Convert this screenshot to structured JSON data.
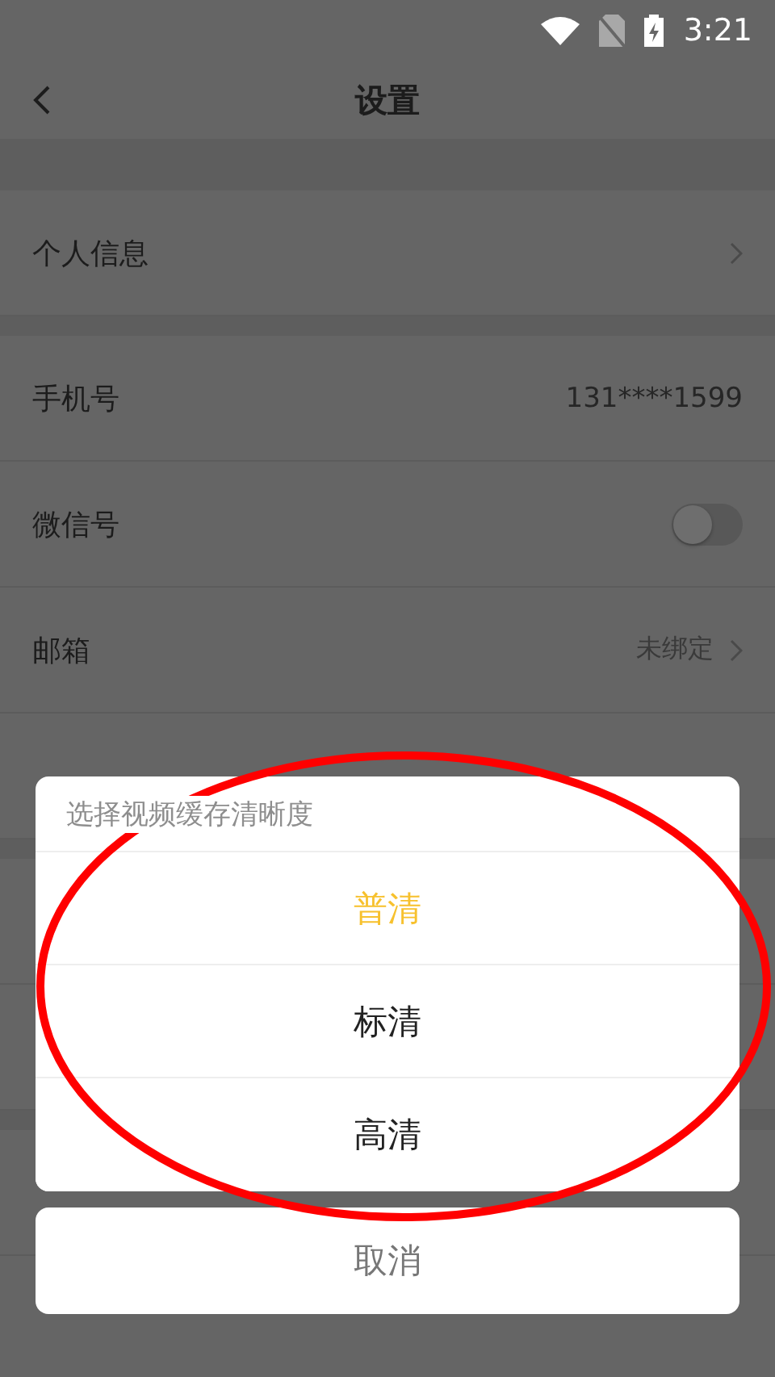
{
  "status_bar": {
    "time": "3:21"
  },
  "header": {
    "title": "设置"
  },
  "groups": [
    {
      "rows": [
        {
          "kind": "link",
          "label": "个人信息"
        }
      ]
    },
    {
      "rows": [
        {
          "kind": "value",
          "label": "手机号",
          "value": "131****1599"
        },
        {
          "kind": "toggle",
          "label": "微信号",
          "on": false
        },
        {
          "kind": "link",
          "label": "邮箱",
          "value": "未绑定"
        },
        {
          "kind": "hidden"
        }
      ]
    },
    {
      "rows": [
        {
          "kind": "hidden"
        },
        {
          "kind": "hidden"
        }
      ]
    },
    {
      "rows": [
        {
          "kind": "hidden"
        },
        {
          "kind": "hidden"
        }
      ]
    }
  ],
  "dialog": {
    "title": "选择视频缓存清晰度",
    "options": [
      {
        "label": "普清",
        "selected": true
      },
      {
        "label": "标清",
        "selected": false
      },
      {
        "label": "高清",
        "selected": false
      }
    ],
    "cancel": "取消"
  }
}
